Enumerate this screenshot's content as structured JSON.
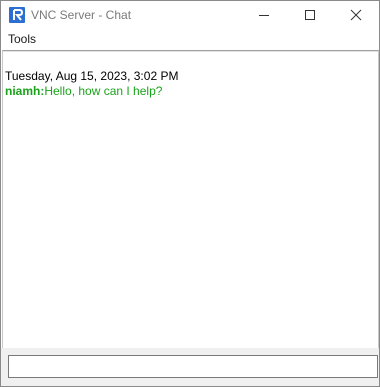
{
  "window": {
    "title": "VNC Server - Chat"
  },
  "menubar": {
    "items": [
      {
        "label": "Tools"
      }
    ]
  },
  "chat": {
    "entries": [
      {
        "timestamp": "Tuesday, Aug 15, 2023, 3:02 PM"
      },
      {
        "sender": "niamh:",
        "text": "Hello, how can I help?"
      }
    ]
  },
  "input": {
    "value": "",
    "placeholder": ""
  },
  "colors": {
    "sender": "#1aa31a",
    "message": "#1aa31a",
    "app_icon": "#2c6fd1"
  },
  "icons": {
    "app": "vnc-logo-icon",
    "minimize": "minimize-icon",
    "maximize": "maximize-icon",
    "close": "close-icon"
  }
}
